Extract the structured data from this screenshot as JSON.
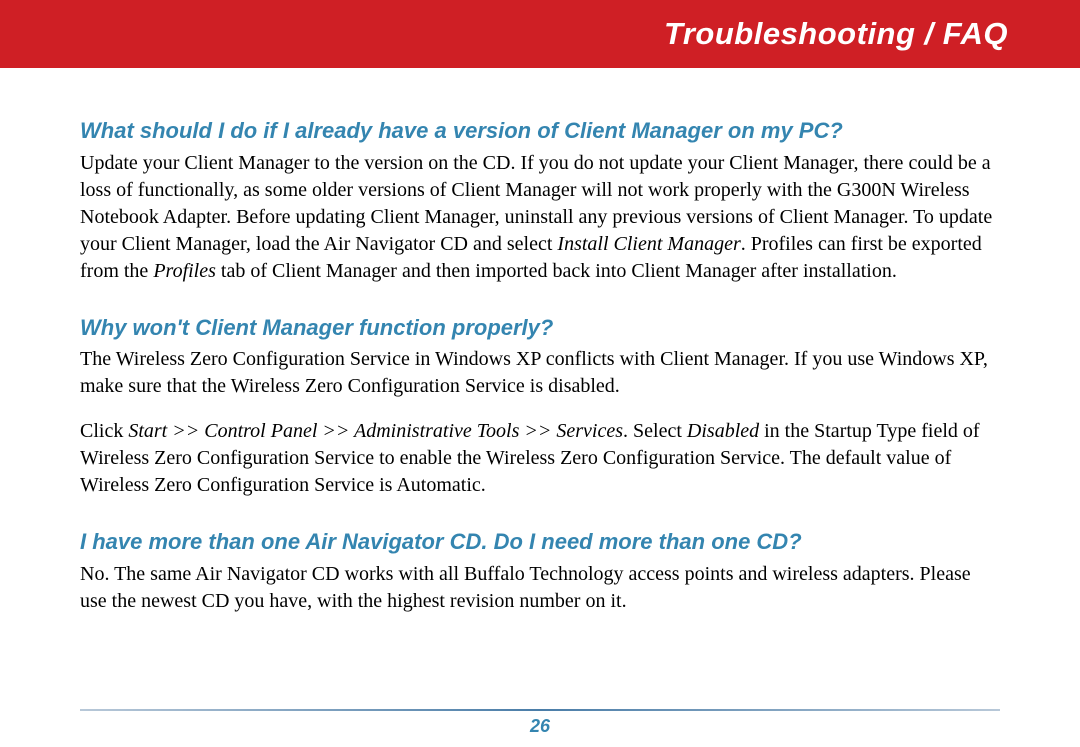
{
  "header": {
    "title": "Troubleshooting / FAQ"
  },
  "faqs": [
    {
      "question": "What should I do if I already have a version of Client Manager on my PC?",
      "answer_parts": {
        "p1a": "Update your Client Manager to the version on the CD. If you do not update your Client Manager, there could be a loss of functionally, as some older versions of Client Manager will not work properly with the G300N Wireless Notebook Adapter. Before updating Client Manager, uninstall any previous versions of Client Manager. To update your Client Manager, load the Air Navigator CD and select ",
        "p1b_italic": "Install Client Manager",
        "p1c": ". Profiles can first be exported from the ",
        "p1d_italic": "Profiles",
        "p1e": " tab of Client Manager and then imported back into Client Manager after installation."
      }
    },
    {
      "question": "Why won't Client Manager function properly?",
      "para1": "The Wireless Zero Configuration Service in Windows XP conflicts with Client Manager.  If you use Windows XP, make sure that the Wireless Zero Configuration Service is disabled.",
      "para2_parts": {
        "a": "Click ",
        "b_italic": "Start >> Control Panel >> Administrative Tools >> Services",
        "c": ". Select ",
        "d_italic": "Disabled",
        "e": " in the Startup Type field of Wireless Zero Configuration Service to enable the Wireless Zero Configuration Service. The default value of Wireless Zero Configuration Service is Automatic."
      }
    },
    {
      "question": "I have more than one Air Navigator CD. Do I need more than one CD?",
      "answer": "No. The same Air Navigator CD works with all Buffalo Technology access points and wireless adapters. Please use the newest CD you have, with the highest revision number on it."
    }
  ],
  "page_number": "26"
}
